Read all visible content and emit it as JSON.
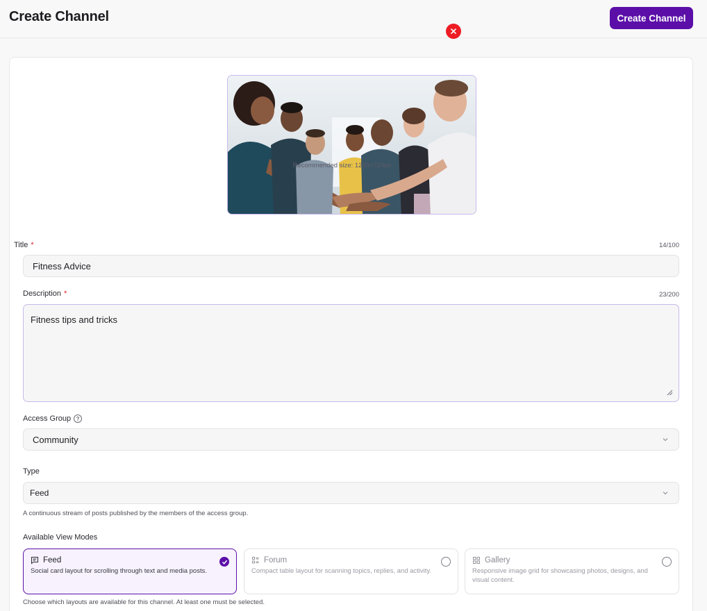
{
  "header": {
    "title": "Create Channel",
    "create_button": "Create Channel"
  },
  "cover": {
    "image_alt": "Group of people stacking hands together in a gym",
    "remove_icon": "close-icon",
    "hint": "Recommended size: 1280×720px"
  },
  "title_field": {
    "label": "Title",
    "required_mark": "*",
    "counter": "14/100",
    "value": "Fitness Advice"
  },
  "description_field": {
    "label": "Description",
    "required_mark": "*",
    "counter": "23/200",
    "value": "Fitness tips and tricks"
  },
  "access_group": {
    "label": "Access Group",
    "help_icon": "question-circle-icon",
    "help_glyph": "?",
    "selected": "Community"
  },
  "type_field": {
    "label": "Type",
    "selected": "Feed",
    "help": "A continuous stream of posts published by the members of the access group."
  },
  "view_modes": {
    "label": "Available View Modes",
    "help": "Choose which layouts are available for this channel. At least one must be selected.",
    "options": [
      {
        "name": "Feed",
        "icon": "chat-lines-icon",
        "description": "Social card layout for scrolling through text and media posts.",
        "selected": true
      },
      {
        "name": "Forum",
        "icon": "table-list-icon",
        "description": "Compact table layout for scanning topics, replies, and activity.",
        "selected": false
      },
      {
        "name": "Gallery",
        "icon": "grid-icon",
        "description": "Responsive image grid for showcasing photos, designs, and visual content.",
        "selected": false
      }
    ]
  },
  "colors": {
    "accent": "#5b0fa8",
    "danger": "#ee1d24",
    "selected_card_bg": "#f7f2fd"
  }
}
